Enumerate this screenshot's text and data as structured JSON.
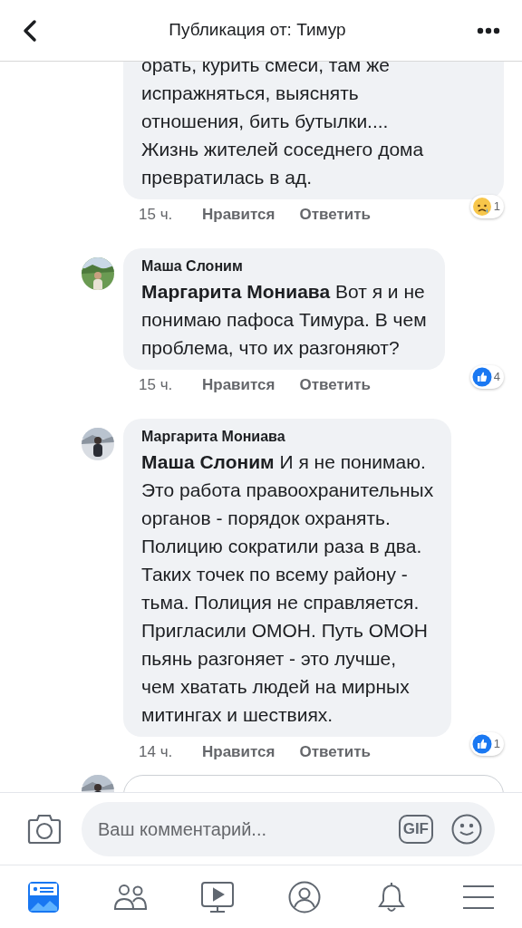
{
  "header": {
    "title": "Публикация от: Тимур"
  },
  "comments": [
    {
      "lines": [
        "орать, курить смеси, там же",
        "испражняться, выяснять",
        "отношения, бить бутылки....",
        "Жизнь жителей соседнего дома",
        "превратилась в ад."
      ],
      "time": "15 ч.",
      "like": "Нравится",
      "reply": "Ответить",
      "reaction": {
        "kind": "sad",
        "count": "1"
      }
    },
    {
      "author": "Маша Слоним",
      "lines": [
        "**Маргарита Мониава** Вот я и не",
        "понимаю пафоса Тимура. В чем",
        "проблема, что их разгоняют?"
      ],
      "time": "15 ч.",
      "like": "Нравится",
      "reply": "Ответить",
      "reaction": {
        "kind": "like",
        "count": "4"
      }
    },
    {
      "author": "Маргарита Мониава",
      "lines": [
        "**Маша Слоним** И я не понимаю.",
        "Это работа правоохранительных",
        "органов - порядок охранять.",
        "Полицию сократили раза в два.",
        "Таких точек по всему району -",
        "тьма. Полиция не справляется.",
        "Пригласили ОМОН. Путь ОМОН",
        "пьянь разгоняет - это лучше,",
        "чем хватать людей на мирных",
        "митингах и шествиях."
      ],
      "time": "14 ч.",
      "like": "Нравится",
      "reply": "Ответить",
      "reaction": {
        "kind": "like",
        "count": "1"
      }
    }
  ],
  "composer": {
    "placeholder": "Ваш комментарий...",
    "gif": "GIF"
  },
  "tabs": [
    {
      "kind": "feed",
      "selected": true
    },
    {
      "kind": "friends",
      "selected": false
    },
    {
      "kind": "video",
      "selected": false
    },
    {
      "kind": "profile",
      "selected": false
    },
    {
      "kind": "bell",
      "selected": false
    },
    {
      "kind": "menu",
      "selected": false
    }
  ]
}
